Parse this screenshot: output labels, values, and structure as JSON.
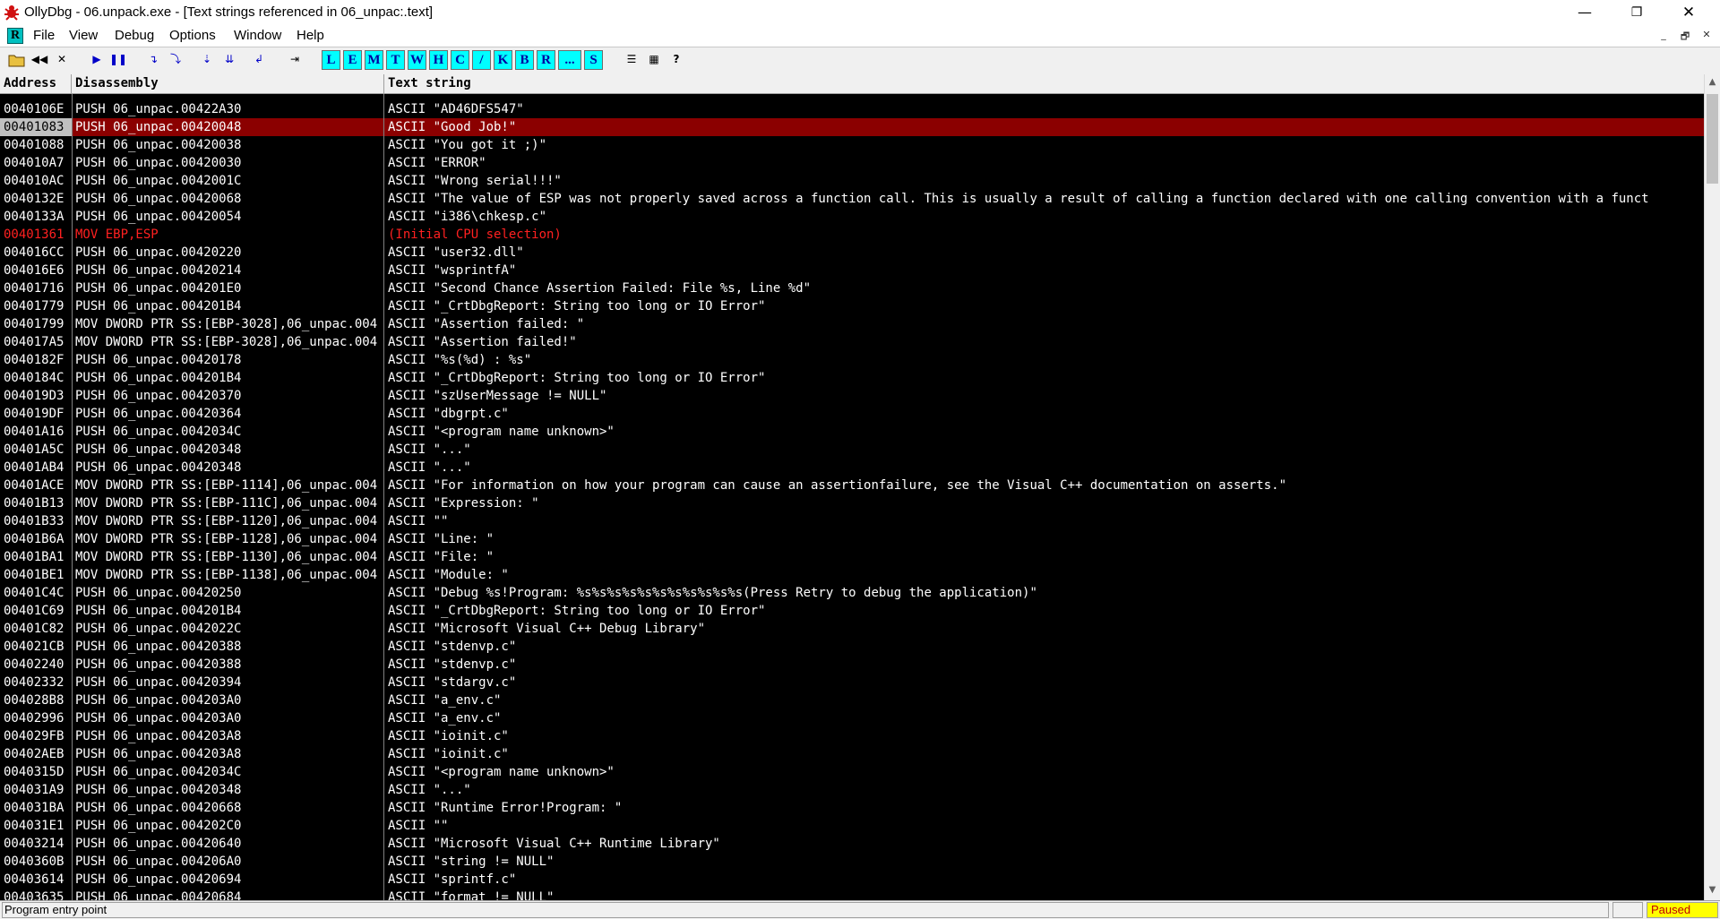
{
  "window": {
    "title": "OllyDbg - 06.unpack.exe - [Text strings referenced in 06_unpac:.text]",
    "min_glyph": "—",
    "max_glyph": "❐",
    "close_glyph": "✕",
    "icon": "bug-icon",
    "accent_color": "#8b0000"
  },
  "menu": {
    "mdi_icon_label": "R",
    "items": [
      "File",
      "View",
      "Debug",
      "Options",
      "Window",
      "Help"
    ],
    "mdi_controls": [
      "_",
      "🗗",
      "✕"
    ]
  },
  "toolbar": {
    "close_glyph": "✕",
    "letter_buttons": [
      "L",
      "E",
      "M",
      "T",
      "W",
      "H",
      "C",
      "/",
      "K",
      "B",
      "R",
      "...",
      "S"
    ],
    "help_glyph": "?"
  },
  "table": {
    "columns": [
      "Address",
      "Disassembly",
      "Text string"
    ],
    "selected_index": 1,
    "cpu_index": 7,
    "rows": [
      [
        "0040106E",
        "PUSH 06_unpac.00422A30",
        "ASCII \"AD46DFS547\""
      ],
      [
        "00401083",
        "PUSH 06_unpac.00420048",
        "ASCII \"Good Job!\""
      ],
      [
        "00401088",
        "PUSH 06_unpac.00420038",
        "ASCII \"You got it ;)\""
      ],
      [
        "004010A7",
        "PUSH 06_unpac.00420030",
        "ASCII \"ERROR\""
      ],
      [
        "004010AC",
        "PUSH 06_unpac.0042001C",
        "ASCII \"Wrong serial!!!\""
      ],
      [
        "0040132E",
        "PUSH 06_unpac.00420068",
        "ASCII \"The value of ESP was not properly saved across a function call.  This is usually a result of calling a function declared with one calling convention with a funct"
      ],
      [
        "0040133A",
        "PUSH 06_unpac.00420054",
        "ASCII \"i386\\chkesp.c\""
      ],
      [
        "00401361",
        "MOV EBP,ESP",
        "(Initial CPU selection)"
      ],
      [
        "004016CC",
        "PUSH 06_unpac.00420220",
        "ASCII \"user32.dll\""
      ],
      [
        "004016E6",
        "PUSH 06_unpac.00420214",
        "ASCII \"wsprintfA\""
      ],
      [
        "00401716",
        "PUSH 06_unpac.004201E0",
        "ASCII \"Second Chance Assertion Failed: File %s, Line %d\""
      ],
      [
        "00401779",
        "PUSH 06_unpac.004201B4",
        "ASCII \"_CrtDbgReport: String too long or IO Error\""
      ],
      [
        "00401799",
        "MOV DWORD PTR SS:[EBP-3028],06_unpac.004",
        "ASCII \"Assertion failed: \""
      ],
      [
        "004017A5",
        "MOV DWORD PTR SS:[EBP-3028],06_unpac.004",
        "ASCII \"Assertion failed!\""
      ],
      [
        "0040182F",
        "PUSH 06_unpac.00420178",
        "ASCII \"%s(%d) : %s\""
      ],
      [
        "0040184C",
        "PUSH 06_unpac.004201B4",
        "ASCII \"_CrtDbgReport: String too long or IO Error\""
      ],
      [
        "004019D3",
        "PUSH 06_unpac.00420370",
        "ASCII \"szUserMessage != NULL\""
      ],
      [
        "004019DF",
        "PUSH 06_unpac.00420364",
        "ASCII \"dbgrpt.c\""
      ],
      [
        "00401A16",
        "PUSH 06_unpac.0042034C",
        "ASCII \"<program name unknown>\""
      ],
      [
        "00401A5C",
        "PUSH 06_unpac.00420348",
        "ASCII \"...\""
      ],
      [
        "00401AB4",
        "PUSH 06_unpac.00420348",
        "ASCII \"...\""
      ],
      [
        "00401ACE",
        "MOV DWORD PTR SS:[EBP-1114],06_unpac.004",
        "ASCII \"For information on how your program can cause an assertionfailure, see the Visual C++ documentation on asserts.\""
      ],
      [
        "00401B13",
        "MOV DWORD PTR SS:[EBP-111C],06_unpac.004",
        "ASCII \"Expression: \""
      ],
      [
        "00401B33",
        "MOV DWORD PTR SS:[EBP-1120],06_unpac.004",
        "ASCII \"\""
      ],
      [
        "00401B6A",
        "MOV DWORD PTR SS:[EBP-1128],06_unpac.004",
        "ASCII \"Line: \""
      ],
      [
        "00401BA1",
        "MOV DWORD PTR SS:[EBP-1130],06_unpac.004",
        "ASCII \"File: \""
      ],
      [
        "00401BE1",
        "MOV DWORD PTR SS:[EBP-1138],06_unpac.004",
        "ASCII \"Module: \""
      ],
      [
        "00401C4C",
        "PUSH 06_unpac.00420250",
        "ASCII \"Debug %s!Program: %s%s%s%s%s%s%s%s%s%s%s(Press Retry to debug the application)\""
      ],
      [
        "00401C69",
        "PUSH 06_unpac.004201B4",
        "ASCII \"_CrtDbgReport: String too long or IO Error\""
      ],
      [
        "00401C82",
        "PUSH 06_unpac.0042022C",
        "ASCII \"Microsoft Visual C++ Debug Library\""
      ],
      [
        "004021CB",
        "PUSH 06_unpac.00420388",
        "ASCII \"stdenvp.c\""
      ],
      [
        "00402240",
        "PUSH 06_unpac.00420388",
        "ASCII \"stdenvp.c\""
      ],
      [
        "00402332",
        "PUSH 06_unpac.00420394",
        "ASCII \"stdargv.c\""
      ],
      [
        "004028B8",
        "PUSH 06_unpac.004203A0",
        "ASCII \"a_env.c\""
      ],
      [
        "00402996",
        "PUSH 06_unpac.004203A0",
        "ASCII \"a_env.c\""
      ],
      [
        "004029FB",
        "PUSH 06_unpac.004203A8",
        "ASCII \"ioinit.c\""
      ],
      [
        "00402AEB",
        "PUSH 06_unpac.004203A8",
        "ASCII \"ioinit.c\""
      ],
      [
        "0040315D",
        "PUSH 06_unpac.0042034C",
        "ASCII \"<program name unknown>\""
      ],
      [
        "004031A9",
        "PUSH 06_unpac.00420348",
        "ASCII \"...\""
      ],
      [
        "004031BA",
        "PUSH 06_unpac.00420668",
        "ASCII \"Runtime Error!Program: \""
      ],
      [
        "004031E1",
        "PUSH 06_unpac.004202C0",
        "ASCII \"\""
      ],
      [
        "00403214",
        "PUSH 06_unpac.00420640",
        "ASCII \"Microsoft Visual C++ Runtime Library\""
      ],
      [
        "0040360B",
        "PUSH 06_unpac.004206A0",
        "ASCII \"string != NULL\""
      ],
      [
        "00403614",
        "PUSH 06_unpac.00420694",
        "ASCII \"sprintf.c\""
      ],
      [
        "00403635",
        "PUSH 06_unpac.00420684",
        "ASCII \"format != NULL\""
      ]
    ]
  },
  "scrollbar": {
    "up_glyph": "▲",
    "down_glyph": "▼"
  },
  "status": {
    "message": "Program entry point",
    "state": "Paused",
    "state_color": "#ffff00"
  }
}
